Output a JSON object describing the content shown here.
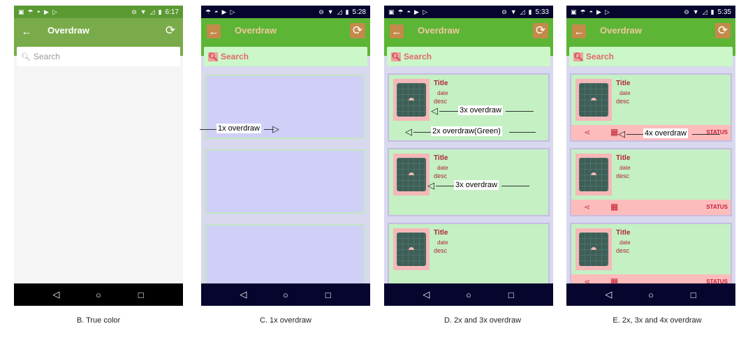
{
  "app": {
    "title": "Overdraw"
  },
  "search": {
    "placeholder": "Search"
  },
  "status_times": {
    "B": "6:17",
    "C": "5:28",
    "D": "5:33",
    "E": "5:35"
  },
  "captions": {
    "B": "B. True color",
    "C": "C. 1x overdraw",
    "D": "D. 2x and 3x overdraw",
    "E": "E. 2x, 3x and 4x overdraw"
  },
  "card": {
    "title": "Title",
    "date": "date",
    "desc": "desc",
    "status": "STATUS"
  },
  "annotations": {
    "c_1x": "1x overdraw",
    "d_3x_a": "3x overdraw",
    "d_2x": "2x overdraw(Green)",
    "d_3x_b": "3x overdraw",
    "e_4x": "4x overdraw"
  },
  "icons": {
    "back": "arrow-left-icon",
    "refresh": "refresh-icon",
    "search": "magnifier-icon",
    "share": "share-icon",
    "calendar": "calendar-icon",
    "nav_back": "triangle-back-icon",
    "nav_home": "circle-home-icon",
    "nav_recent": "square-recent-icon"
  },
  "colors": {
    "true_color_appbar": "#7aab4a",
    "overdraw_blue": "#cfcff8",
    "overdraw_green": "#c4f0c4",
    "overdraw_pink": "#f5b8b8",
    "overdraw_red": "#fdbcbc"
  }
}
